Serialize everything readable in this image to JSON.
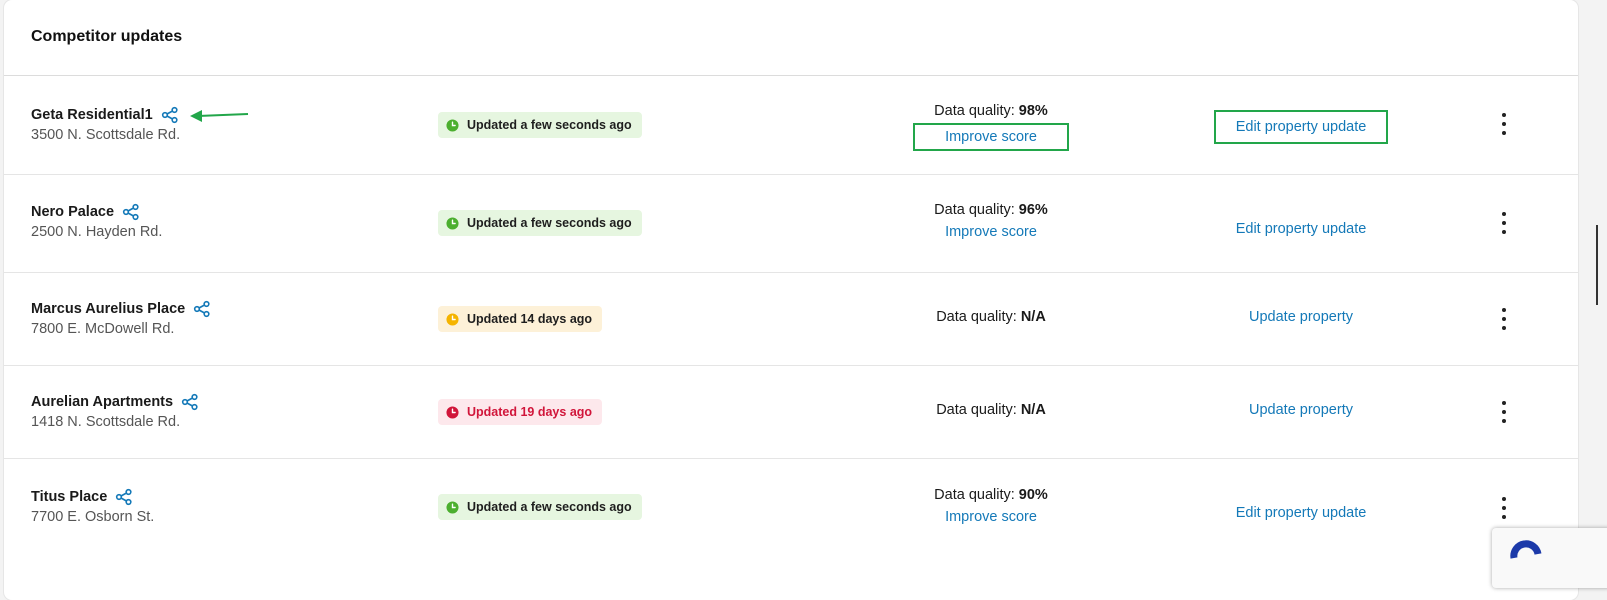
{
  "card": {
    "title": "Competitor updates"
  },
  "rows": [
    {
      "name": "Geta Residential1",
      "address": "3500 N. Scottsdale Rd.",
      "status": "Updated a few seconds ago",
      "status_tone": "green",
      "quality_label": "Data quality:",
      "quality_value": "98%",
      "improve_label": "Improve score",
      "action_label": "Edit property update"
    },
    {
      "name": "Nero Palace",
      "address": "2500 N. Hayden Rd.",
      "status": "Updated a few seconds ago",
      "status_tone": "green",
      "quality_label": "Data quality:",
      "quality_value": "96%",
      "improve_label": "Improve score",
      "action_label": "Edit property update"
    },
    {
      "name": "Marcus Aurelius Place",
      "address": "7800 E. McDowell Rd.",
      "status": "Updated 14 days ago",
      "status_tone": "yellow",
      "quality_label": "Data quality:",
      "quality_value": "N/A",
      "action_label": "Update property"
    },
    {
      "name": "Aurelian Apartments",
      "address": "1418 N. Scottsdale Rd.",
      "status": "Updated 19 days ago",
      "status_tone": "red",
      "quality_label": "Data quality:",
      "quality_value": "N/A",
      "action_label": "Update property"
    },
    {
      "name": "Titus Place",
      "address": "7700 E. Osborn St.",
      "status": "Updated a few seconds ago",
      "status_tone": "green",
      "quality_label": "Data quality:",
      "quality_value": "90%",
      "improve_label": "Improve score",
      "action_label": "Edit property update"
    }
  ],
  "colors": {
    "link": "#1479b8",
    "status_green": "#4caf2f",
    "status_yellow": "#f5b400",
    "status_red": "#d1153a",
    "annotation_green": "#22a64a"
  },
  "icons": {
    "share": "share-icon",
    "clock": "clock-icon",
    "more": "more-vertical-icon",
    "annotation_arrow": "arrow-left-icon"
  }
}
